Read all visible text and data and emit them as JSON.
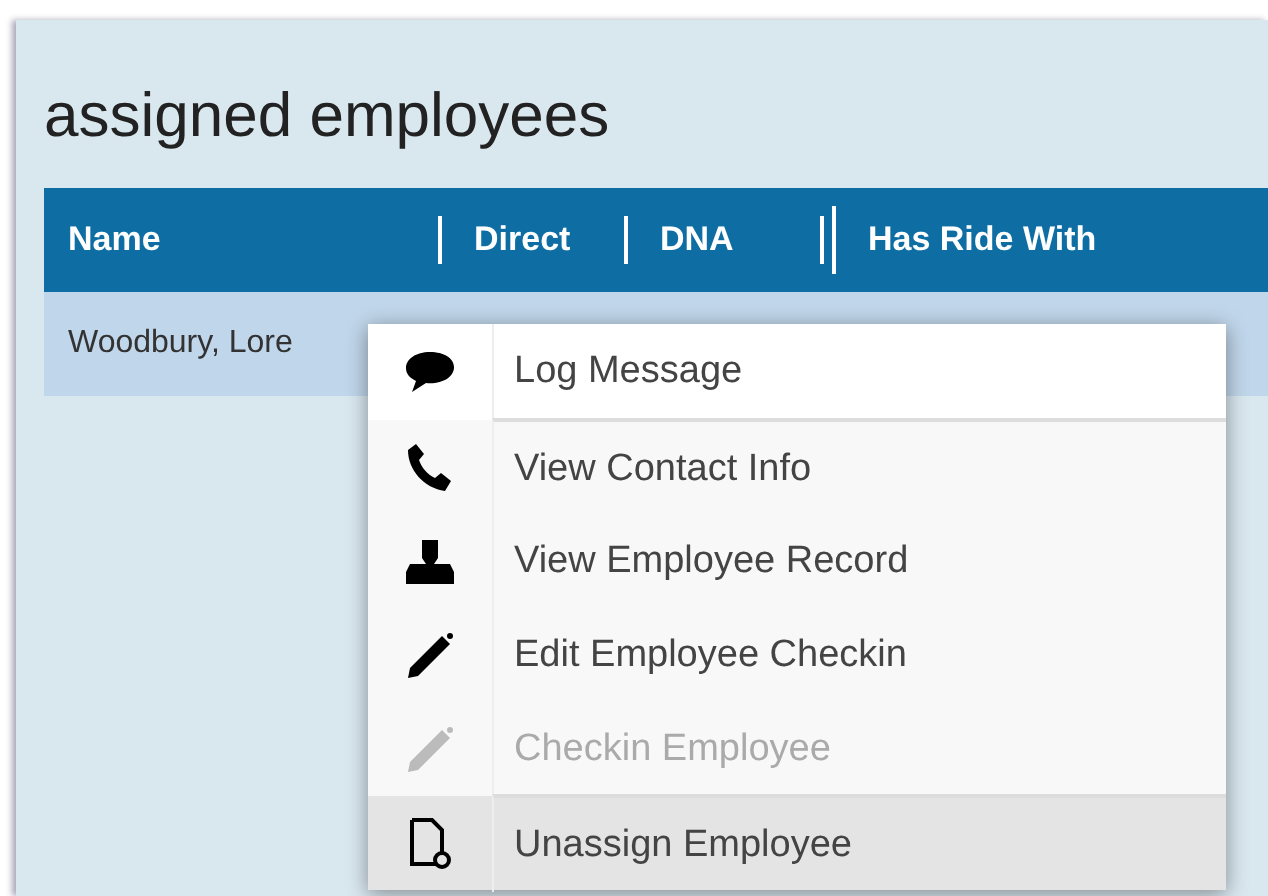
{
  "title": "assigned employees",
  "table": {
    "columns": [
      "Name",
      "Direct",
      "DNA",
      "",
      "Has Ride With"
    ],
    "rows": [
      {
        "cells": [
          "Woodbury, Lore"
        ],
        "selected": true
      }
    ]
  },
  "context_menu": {
    "items": [
      {
        "kind": "message",
        "label": "Log Message",
        "disabled": false,
        "selected": false,
        "divider_above": false
      },
      {
        "kind": "phone",
        "label": "View Contact Info",
        "disabled": false,
        "selected": false,
        "divider_above": true
      },
      {
        "kind": "person",
        "label": "View Employee Record",
        "disabled": false,
        "selected": false,
        "divider_above": false
      },
      {
        "kind": "pencil",
        "label": "Edit Employee Checkin",
        "disabled": false,
        "selected": false,
        "divider_above": false
      },
      {
        "kind": "pencil",
        "label": "Checkin Employee",
        "disabled": true,
        "selected": false,
        "divider_above": false
      },
      {
        "kind": "document",
        "label": "Unassign Employee",
        "disabled": false,
        "selected": true,
        "divider_above": true
      }
    ]
  }
}
